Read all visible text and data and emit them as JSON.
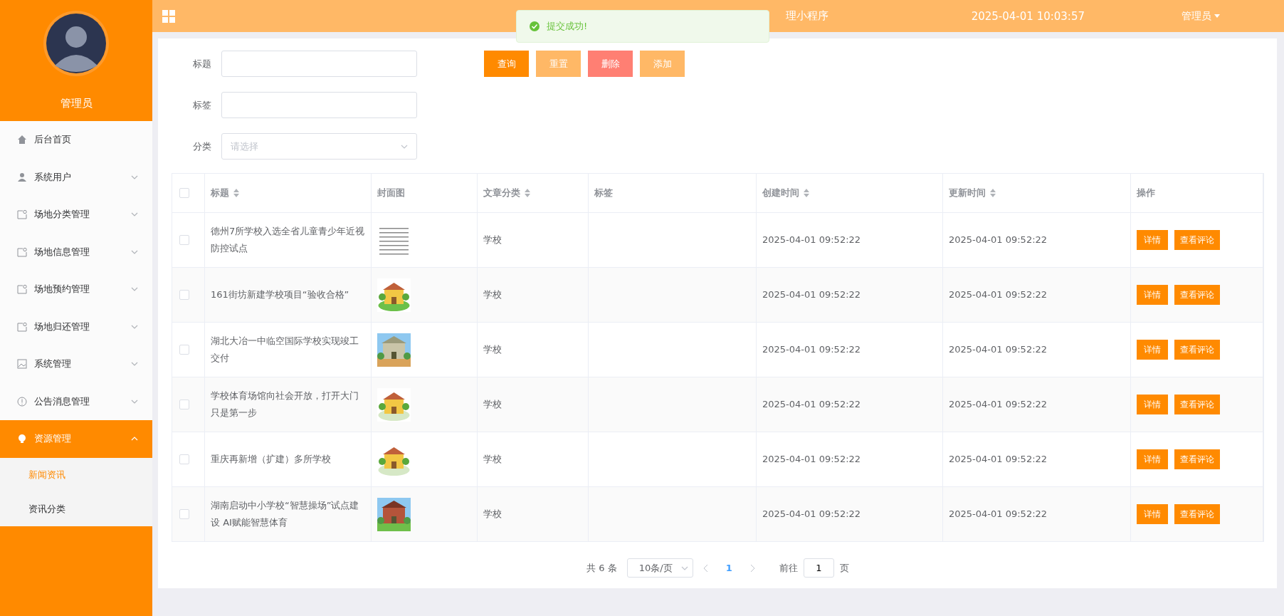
{
  "header": {
    "title": "理小程序",
    "datetime": "2025-04-01 10:03:57",
    "user": "管理员"
  },
  "toast": {
    "message": "提交成功!"
  },
  "sidebar": {
    "user": "管理员",
    "items": [
      {
        "label": "后台首页",
        "kind": "link",
        "expanded": false
      },
      {
        "label": "系统用户",
        "kind": "menu",
        "expanded": false
      },
      {
        "label": "场地分类管理",
        "kind": "menu",
        "expanded": false
      },
      {
        "label": "场地信息管理",
        "kind": "menu",
        "expanded": false
      },
      {
        "label": "场地预约管理",
        "kind": "menu",
        "expanded": false
      },
      {
        "label": "场地归还管理",
        "kind": "menu",
        "expanded": false
      },
      {
        "label": "系统管理",
        "kind": "menu",
        "expanded": false
      },
      {
        "label": "公告消息管理",
        "kind": "menu",
        "expanded": false
      },
      {
        "label": "资源管理",
        "kind": "menu",
        "expanded": true,
        "children": [
          {
            "label": "新闻资讯",
            "selected": true
          },
          {
            "label": "资讯分类",
            "selected": false
          }
        ]
      }
    ]
  },
  "filters": [
    {
      "label": "标题",
      "kind": "text"
    },
    {
      "label": "标签",
      "kind": "text"
    },
    {
      "label": "分类",
      "kind": "select",
      "placeholder": "请选择"
    }
  ],
  "buttons": [
    {
      "label": "查询",
      "kind": "primary"
    },
    {
      "label": "重置",
      "kind": "light"
    },
    {
      "label": "删除",
      "kind": "danger"
    },
    {
      "label": "添加",
      "kind": "light"
    }
  ],
  "table": {
    "select_all": {
      "checked": false
    },
    "columns": [
      {
        "label": "标题",
        "sortable": true
      },
      {
        "label": "封面图",
        "sortable": false
      },
      {
        "label": "文章分类",
        "sortable": true
      },
      {
        "label": "标签",
        "sortable": false
      },
      {
        "label": "创建时间",
        "sortable": true
      },
      {
        "label": "更新时间",
        "sortable": true
      },
      {
        "label": "操作",
        "sortable": false
      }
    ],
    "rows": [
      {
        "checked": false,
        "title": "德州7所学校入选全省儿童青少年近视防控试点",
        "cover": {
          "kind": "picture"
        },
        "category": "学校",
        "created": "2025-04-01 09:52:22",
        "updated": "2025-04-01 09:52:22",
        "actions": [
          "详情",
          "查看评论"
        ]
      },
      {
        "checked": false,
        "title": "161街坊新建学校项目“验收合格”",
        "cover": {
          "kind": "picture"
        },
        "category": "学校",
        "created": "2025-04-01 09:52:22",
        "updated": "2025-04-01 09:52:22",
        "actions": [
          "详情",
          "查看评论"
        ]
      },
      {
        "checked": false,
        "title": "湖北大冶一中临空国际学校实现竣工交付",
        "cover": {
          "kind": "picture"
        },
        "category": "学校",
        "created": "2025-04-01 09:52:22",
        "updated": "2025-04-01 09:52:22",
        "actions": [
          "详情",
          "查看评论"
        ]
      },
      {
        "checked": false,
        "title": "学校体育场馆向社会开放，打开大门只是第一步",
        "cover": {
          "kind": "picture"
        },
        "category": "学校",
        "created": "2025-04-01 09:52:22",
        "updated": "2025-04-01 09:52:22",
        "actions": [
          "详情",
          "查看评论"
        ]
      },
      {
        "checked": false,
        "title": "重庆再新增（扩建）多所学校",
        "cover": {
          "kind": "picture"
        },
        "category": "学校",
        "created": "2025-04-01 09:52:22",
        "updated": "2025-04-01 09:52:22",
        "actions": [
          "详情",
          "查看评论"
        ]
      },
      {
        "checked": false,
        "title": "湖南启动中小学校“智慧操场”试点建设 AI赋能智慧体育",
        "cover": {
          "kind": "picture"
        },
        "category": "学校",
        "created": "2025-04-01 09:52:22",
        "updated": "2025-04-01 09:52:22",
        "actions": [
          "详情",
          "查看评论"
        ]
      }
    ]
  },
  "pagination": {
    "total": "共 6 条",
    "page_size": "10条/页",
    "pages": [
      {
        "label": "1",
        "selected": true
      }
    ],
    "goto_label": "前往",
    "goto_value": "1",
    "goto_suffix": "页"
  }
}
